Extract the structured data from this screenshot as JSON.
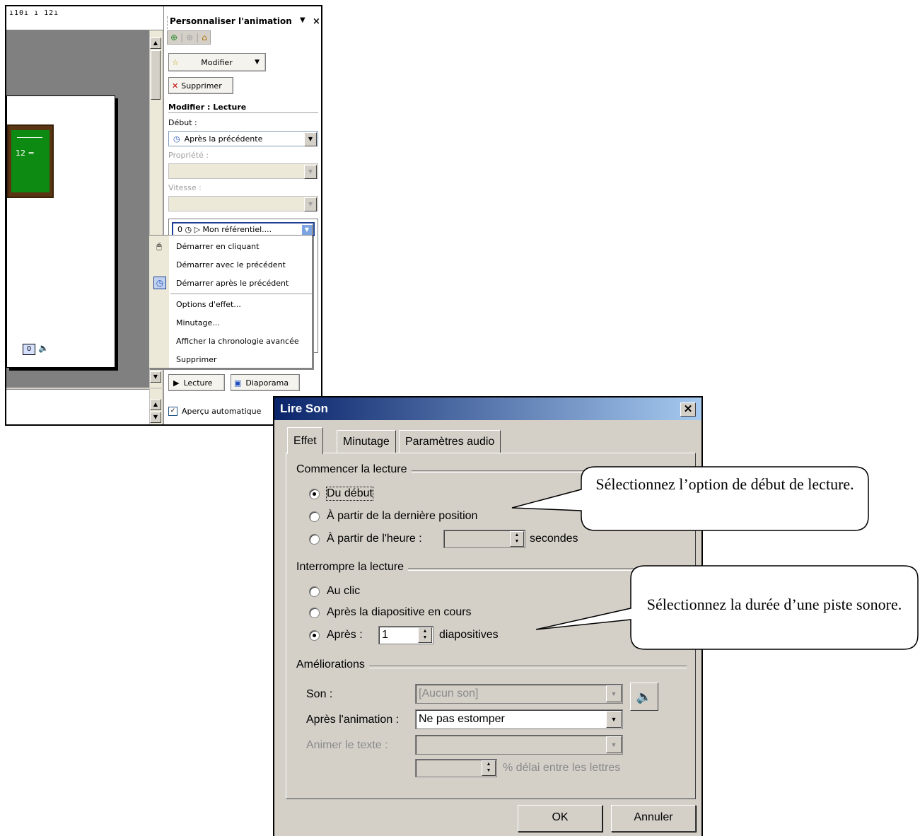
{
  "ruler": {
    "text": "ı10ı ı 12ı"
  },
  "slide": {
    "board_text": "12 =",
    "counter": "0"
  },
  "task_pane": {
    "title": "Personnaliser l'animation",
    "modifier_label": "Modifier",
    "supprimer_label": "Supprimer",
    "modify_heading": "Modifier : Lecture",
    "debut_label": "Début :",
    "debut_value": "Après la précédente",
    "propriete_label": "Propriété :",
    "vitesse_label": "Vitesse :",
    "list_item": "0 ◷   ▷  Mon référentiel....",
    "lecture_label": "Lecture",
    "diaporama_label": "Diaporama",
    "apercu_label": "Aperçu automatique"
  },
  "context_menu": {
    "items": [
      "Démarrer en cliquant",
      "Démarrer avec le précédent",
      "Démarrer après le précédent",
      "Options d'effet...",
      "Minutage...",
      "Afficher la chronologie avancée",
      "Supprimer"
    ]
  },
  "dialog": {
    "title": "Lire Son",
    "tabs": [
      "Effet",
      "Minutage",
      "Paramètres audio"
    ],
    "group_start": "Commencer la lecture",
    "start_options": [
      "Du début",
      "À partir de la dernière position",
      "À partir de l'heure :"
    ],
    "start_selected": 0,
    "seconds_label": "secondes",
    "group_stop": "Interrompre la lecture",
    "stop_options": [
      "Au clic",
      "Après la diapositive en cours",
      "Après :"
    ],
    "stop_selected": 2,
    "after_value": "1",
    "slides_label": "diapositives",
    "group_enh": "Améliorations",
    "son_label": "Son :",
    "son_value": "[Aucun son]",
    "after_anim_label": "Après l'animation :",
    "after_anim_value": "Ne pas estomper",
    "animate_text_label": "Animer le texte :",
    "delay_label": "% délai entre les lettres",
    "ok_label": "OK",
    "cancel_label": "Annuler"
  },
  "callouts": {
    "first": "Sélectionnez l’option de début de lecture.",
    "second": "Sélectionnez la durée d’une piste sonore."
  }
}
